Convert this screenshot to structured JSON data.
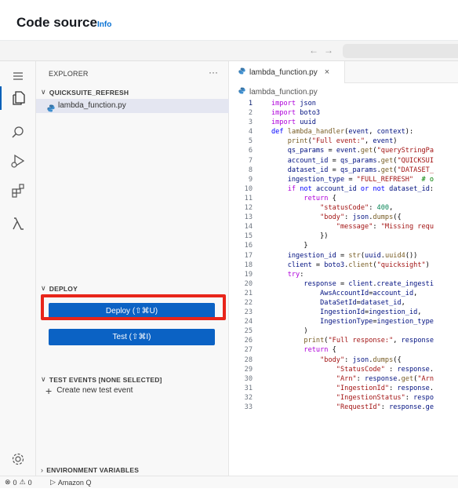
{
  "header": {
    "title": "Code source",
    "info_link": "Info"
  },
  "nav": {
    "back": "←",
    "forward": "→"
  },
  "activity_bar": {
    "icons": [
      "menu-icon",
      "files-icon",
      "search-icon",
      "run-debug-icon",
      "extensions-icon",
      "lambda-icon",
      "settings-gear-icon"
    ]
  },
  "sidebar": {
    "title": "EXPLORER",
    "more": "···",
    "folder": "QUICKSUITE_REFRESH",
    "file": "lambda_function.py",
    "deploy_section": "DEPLOY",
    "deploy_button": "Deploy (⇧⌘U)",
    "test_button": "Test (⇧⌘I)",
    "test_events_section": "TEST EVENTS [NONE SELECTED]",
    "create_test_event": "Create new test event",
    "env_vars_section": "ENVIRONMENT VARIABLES"
  },
  "editor": {
    "tab_label": "lambda_function.py",
    "tab_close": "×",
    "breadcrumb": "lambda_function.py",
    "active_line": 1,
    "lines": [
      {
        "n": "1",
        "text": "import json"
      },
      {
        "n": "2",
        "text": "import boto3"
      },
      {
        "n": "3",
        "text": "import uuid"
      },
      {
        "n": "4",
        "text": "def lambda_handler(event, context):"
      },
      {
        "n": "5",
        "text": "    print(\"Full event:\", event)"
      },
      {
        "n": "6",
        "text": "    qs_params = event.get(\"queryStringPa"
      },
      {
        "n": "7",
        "text": "    account_id = qs_params.get(\"QUICKSUI"
      },
      {
        "n": "8",
        "text": "    dataset_id = qs_params.get(\"DATASET_"
      },
      {
        "n": "9",
        "text": "    ingestion_type = \"FULL_REFRESH\"  # o"
      },
      {
        "n": "10",
        "text": "    if not account_id or not dataset_id:"
      },
      {
        "n": "11",
        "text": "        return {"
      },
      {
        "n": "12",
        "text": "            \"statusCode\": 400,"
      },
      {
        "n": "13",
        "text": "            \"body\": json.dumps({"
      },
      {
        "n": "14",
        "text": "                \"message\": \"Missing requ"
      },
      {
        "n": "15",
        "text": "            })"
      },
      {
        "n": "16",
        "text": "        }"
      },
      {
        "n": "17",
        "text": "    ingestion_id = str(uuid.uuid4())"
      },
      {
        "n": "18",
        "text": "    client = boto3.client(\"quicksight\")"
      },
      {
        "n": "19",
        "text": "    try:"
      },
      {
        "n": "20",
        "text": "        response = client.create_ingesti"
      },
      {
        "n": "21",
        "text": "            AwsAccountId=account_id,"
      },
      {
        "n": "22",
        "text": "            DataSetId=dataset_id,"
      },
      {
        "n": "23",
        "text": "            IngestionId=ingestion_id,"
      },
      {
        "n": "24",
        "text": "            IngestionType=ingestion_type"
      },
      {
        "n": "25",
        "text": "        )"
      },
      {
        "n": "26",
        "text": "        print(\"Full response:\", response"
      },
      {
        "n": "27",
        "text": "        return {"
      },
      {
        "n": "28",
        "text": "            \"body\": json.dumps({"
      },
      {
        "n": "29",
        "text": "                \"StatusCode\" : response."
      },
      {
        "n": "30",
        "text": "                \"Arn\": response.get(\"Arn"
      },
      {
        "n": "31",
        "text": "                \"IngestionId\": response."
      },
      {
        "n": "32",
        "text": "                \"IngestionStatus\": respo"
      },
      {
        "n": "33",
        "text": "                \"RequestId\": response.ge"
      }
    ]
  },
  "status_bar": {
    "errors": "0",
    "warnings": "0",
    "amazon_q": "Amazon Q"
  }
}
